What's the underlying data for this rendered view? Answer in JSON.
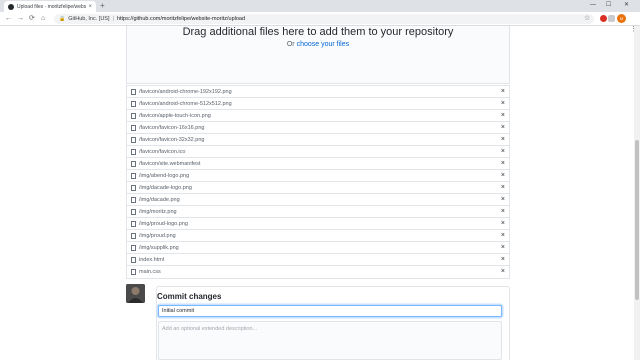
{
  "browser": {
    "tab_title": "Upload files · moritzfelipe/website",
    "tab_close": "×",
    "new_tab": "+",
    "window_controls": [
      "—",
      "☐",
      "✕"
    ],
    "nav": {
      "back": "←",
      "forward": "→",
      "reload": "⟳",
      "home": "⌂"
    },
    "site_identity": "GitHub, Inc. [US]",
    "separator": "|",
    "url": "https://github.com/moritzfelipe/website-moritz/upload",
    "profile_initial": "M"
  },
  "dropzone": {
    "title": "Drag additional files here to add them to your repository",
    "or_text": "Or ",
    "choose_link": "choose your files"
  },
  "files": [
    {
      "name": "/favicon/android-chrome-192x192.png"
    },
    {
      "name": "/favicon/android-chrome-512x512.png"
    },
    {
      "name": "/favicon/apple-touch-icon.png"
    },
    {
      "name": "/favicon/favicon-16x16.png"
    },
    {
      "name": "/favicon/favicon-32x32.png"
    },
    {
      "name": "/favicon/favicon.ico"
    },
    {
      "name": "/favicon/site.webmanifest"
    },
    {
      "name": "/img/abend-logo.png"
    },
    {
      "name": "/img/dacade-logo.png"
    },
    {
      "name": "/img/dacade.png"
    },
    {
      "name": "/img/moritz.png"
    },
    {
      "name": "/img/proud-logo.png"
    },
    {
      "name": "/img/proud.png"
    },
    {
      "name": "/img/supplik.png"
    },
    {
      "name": "index.html"
    },
    {
      "name": "main.css"
    }
  ],
  "remove_glyph": "×",
  "commit": {
    "title": "Commit changes",
    "summary_value": "Initial commit",
    "description_placeholder": "Add an optional extended description..."
  }
}
